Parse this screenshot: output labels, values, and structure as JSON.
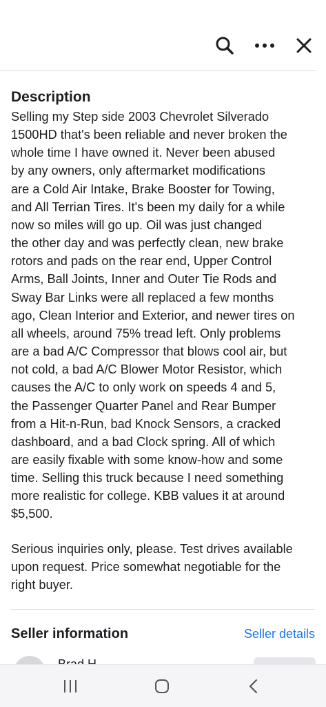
{
  "header": {
    "icons": [
      "search-icon",
      "more-icon",
      "close-icon"
    ]
  },
  "description": {
    "title": "Description",
    "paragraphs": [
      "Selling my Step side 2003 Chevrolet Silverado\n1500HD that's been reliable and never broken the\nwhole time I have owned it. Never been abused\nby any owners, only aftermarket modifications\nare a Cold Air Intake, Brake Booster for Towing,\nand All Terrian Tires. It's been my daily for a while\nnow so miles will go up. Oil was just changed\nthe other day and was perfectly clean, new brake\nrotors and pads on the rear end, Upper Control\nArms, Ball Joints, Inner and Outer Tie Rods and\nSway Bar Links were all replaced a few months\nago, Clean Interior and Exterior, and newer tires on\nall wheels, around 75% tread left. Only problems\nare a bad A/C Compressor that blows cool air, but\nnot cold, a bad A/C Blower Motor Resistor, which\ncauses the A/C to only work on speeds 4 and 5,\nthe Passenger Quarter Panel and Rear Bumper\nfrom a Hit-n-Run, bad Knock Sensors, a cracked\ndashboard, and a bad Clock spring. All of which\nare easily fixable with some know-how and some\ntime. Selling this truck because I need something\nmore realistic for college. KBB values it at around\n$5,500.",
      "Serious inquiries only, please. Test drives available\nupon request. Price somewhat negotiable for the\nright buyer."
    ]
  },
  "seller": {
    "title": "Seller information",
    "details_link": "Seller details",
    "name_partial": "Brad H"
  },
  "navbar": {
    "icons": [
      "recents-icon",
      "home-icon",
      "back-icon"
    ]
  },
  "colors": {
    "link": "#1877f2",
    "text": "#1c1e21",
    "divider": "#dadde1"
  }
}
